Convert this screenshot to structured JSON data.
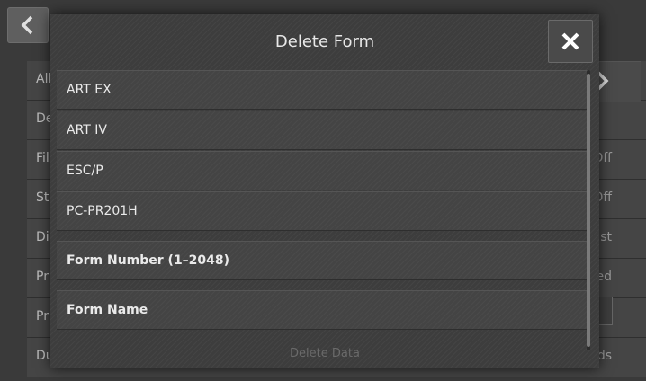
{
  "background": {
    "rows": [
      {
        "label": "All",
        "value": ""
      },
      {
        "label": "De",
        "value": ""
      },
      {
        "label": "Fil",
        "value": "Off"
      },
      {
        "label": "St",
        "value": "Off"
      },
      {
        "label": "Di",
        "value": "ist"
      },
      {
        "label": "Pr",
        "value": "ed"
      },
      {
        "label": "Pr",
        "value": ""
      },
      {
        "label": "Du",
        "value": "ds"
      }
    ]
  },
  "modal": {
    "title": "Delete Form",
    "forms": [
      "ART EX",
      "ART IV",
      "ESC/P",
      "PC-PR201H"
    ],
    "form_number_label": "Form Number (1–2048)",
    "form_name_label": "Form Name",
    "delete_label": "Delete Data"
  }
}
